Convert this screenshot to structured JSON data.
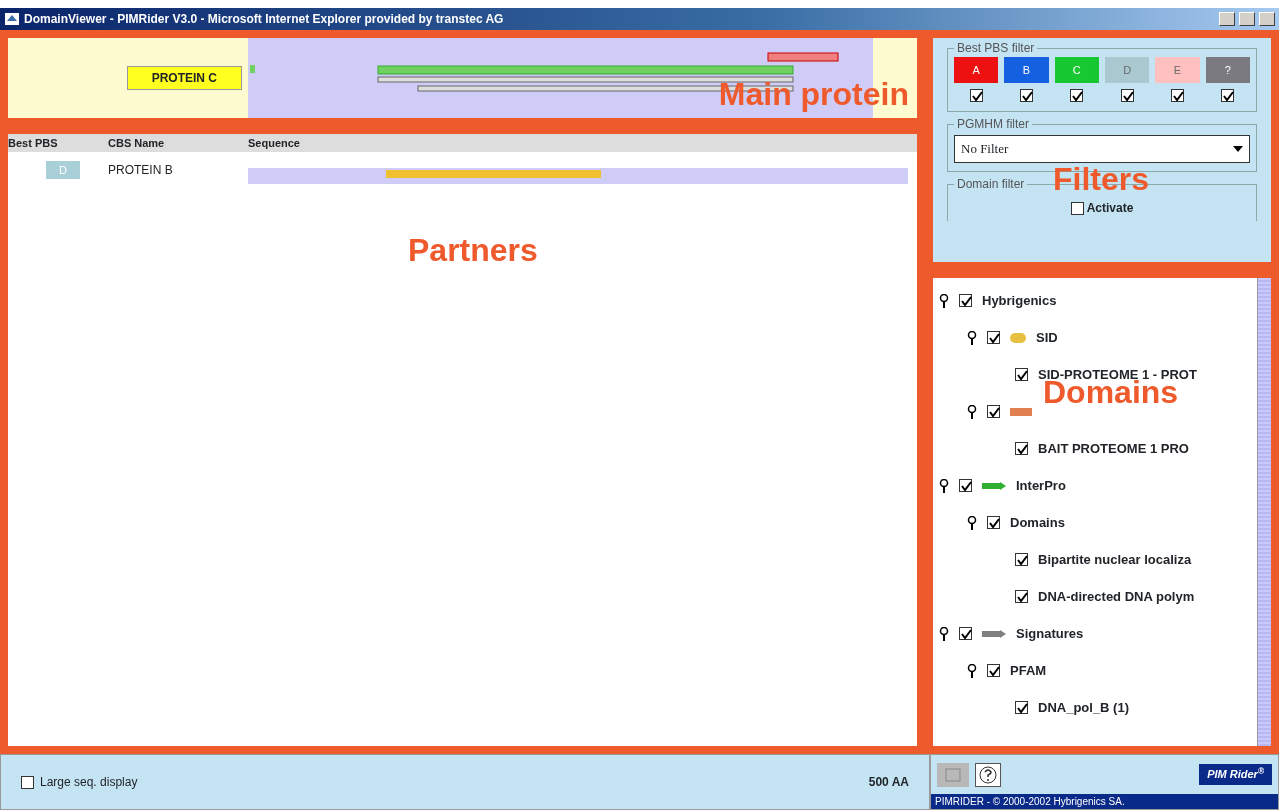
{
  "window": {
    "title": "DomainViewer - PIMRider V3.0 - Microsoft Internet Explorer provided by transtec AG"
  },
  "main_protein": {
    "name": "PROTEIN C",
    "annotation": "Main protein"
  },
  "partners": {
    "annotation": "Partners",
    "columns": [
      "Best PBS",
      "CBS Name",
      "Sequence"
    ],
    "rows": [
      {
        "pbs": "D",
        "color": "#a9d0d8",
        "name": "PROTEIN B"
      }
    ]
  },
  "filters": {
    "annotation": "Filters",
    "pbs_filter": {
      "title": "Best PBS filter",
      "grades": [
        {
          "label": "A",
          "color": "#ee1111",
          "checked": true
        },
        {
          "label": "B",
          "color": "#1560e0",
          "checked": true
        },
        {
          "label": "C",
          "color": "#18c832",
          "checked": true
        },
        {
          "label": "D",
          "color": "#a9c8d0",
          "checked": true
        },
        {
          "label": "E",
          "color": "#ffc0c0",
          "checked": true
        },
        {
          "label": "?",
          "color": "#7a7a80",
          "checked": true
        }
      ]
    },
    "pgmhm_filter": {
      "title": "PGMHM filter",
      "value": "No Filter"
    },
    "domain_filter": {
      "title": "Domain filter",
      "label": "Activate",
      "checked": false
    }
  },
  "domains": {
    "annotation": "Domains",
    "tree": [
      {
        "label": "Hybrigenics",
        "checked": true,
        "expanded": true,
        "children": [
          {
            "label": "SID",
            "kind": "oval",
            "color": "#e8c040",
            "checked": true,
            "expanded": true,
            "children": [
              {
                "label": "SID-PROTEOME 1 - PROT",
                "checked": true
              }
            ]
          },
          {
            "kind": "bar",
            "color": "#e08050",
            "checked": true,
            "expanded": true,
            "children": [
              {
                "label": "BAIT PROTEOME 1   PRO",
                "checked": true
              }
            ]
          }
        ]
      },
      {
        "label": "InterPro",
        "kind": "arrow",
        "color": "#30b030",
        "checked": true,
        "expanded": true,
        "children": [
          {
            "label": "Domains",
            "checked": true,
            "expanded": true,
            "children": [
              {
                "label": "Bipartite nuclear localiza",
                "checked": true
              },
              {
                "label": "DNA-directed DNA polym",
                "checked": true
              }
            ]
          }
        ]
      },
      {
        "label": "Signatures",
        "kind": "arrow",
        "color": "#808080",
        "checked": true,
        "expanded": true,
        "children": [
          {
            "label": "PFAM",
            "checked": true,
            "expanded": true,
            "children": [
              {
                "label": "DNA_pol_B (1)",
                "checked": true
              }
            ]
          }
        ]
      }
    ]
  },
  "bottom": {
    "large_seq_display": {
      "label": "Large seq. display",
      "checked": false
    },
    "scale": "500 AA",
    "logo": "PIM Rider$^{®}$",
    "footer": "PIMRIDER - © 2000-2002 Hybrigenics SA."
  }
}
